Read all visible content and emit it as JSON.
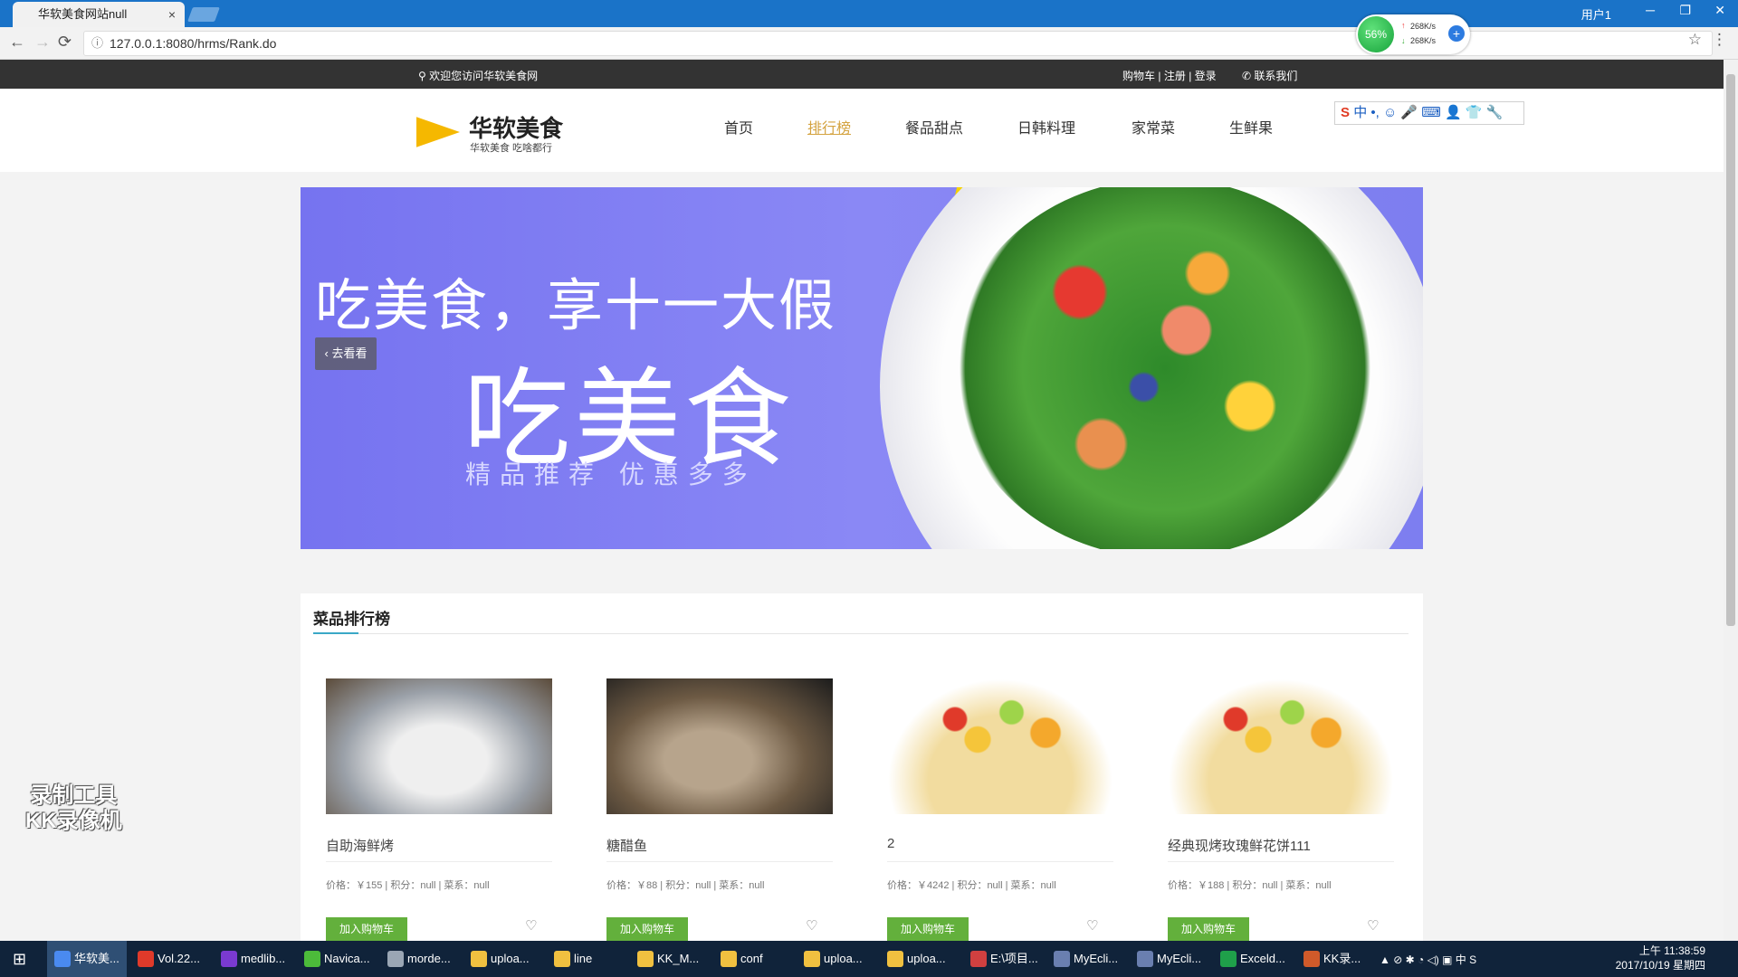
{
  "browser": {
    "tab_title": "华软美食网站null",
    "tab_close": "×",
    "user": "用户1",
    "win_min": "─",
    "win_restore": "❐",
    "win_close": "✕",
    "back": "←",
    "forward": "→",
    "reload": "⟳",
    "info": "ⓘ",
    "url": "127.0.0.1:8080/hrms/Rank.do",
    "bookmark": "☆",
    "menu": "⋮"
  },
  "netmon": {
    "percent": "56%",
    "up": "268K/s",
    "down": "268K/s",
    "up_arrow": "↑",
    "down_arrow": "↓",
    "plus": "+"
  },
  "topbar": {
    "welcome": "欢迎您访问华软美食网",
    "cart": "购物车",
    "sep1": "|",
    "register": "注册",
    "sep2": "|",
    "login": "登录",
    "contact": "联系我们"
  },
  "logo": {
    "title": "华软美食",
    "subtitle": "华软美食  吃啥都行"
  },
  "nav": [
    "首页",
    "排行榜",
    "餐品甜点",
    "日韩料理",
    "家常菜",
    "生鲜果"
  ],
  "ime": {
    "s": "S",
    "tools": "中 •, ☺ 🎤 ⌨ 👤 👕 🔧"
  },
  "banner": {
    "headline": "吃美食，享十一大假",
    "big": "吃美食",
    "sub": "精品推荐  优惠多多",
    "prev_label": "去看看",
    "prev_arrow": "‹"
  },
  "rank": {
    "title": "菜品排行榜",
    "items": [
      {
        "name": "自助海鲜烤",
        "meta": "价格：￥155 | 积分：null | 菜系：null",
        "cart": "加入购物车"
      },
      {
        "name": "糖醋鱼",
        "meta": "价格：￥88 | 积分：null | 菜系：null",
        "cart": "加入购物车"
      },
      {
        "name": "2",
        "meta": "价格：￥4242 | 积分：null | 菜系：null",
        "cart": "加入购物车"
      },
      {
        "name": "经典现烤玫瑰鲜花饼111",
        "meta": "价格：￥188 | 积分：null | 菜系：null",
        "cart": "加入购物车"
      }
    ],
    "fav": "♡"
  },
  "watermark": {
    "line1": "录制工具",
    "line2": "KK录像机"
  },
  "taskbar": {
    "start": "⊞",
    "items": [
      "华软美...",
      "Vol.22...",
      "medlib...",
      "Navica...",
      "morde...",
      "uploa...",
      "line",
      "KK_M...",
      "conf",
      "uploa...",
      "uploa...",
      "E:\\项目...",
      "MyEcli...",
      "MyEcli...",
      "Exceld...",
      "KK录..."
    ],
    "tray": "▲  ⊘  ✱   ◔  ◁)  ▣  中  S",
    "time": "上午 11:38:59",
    "date": "2017/10/19 星期四"
  }
}
